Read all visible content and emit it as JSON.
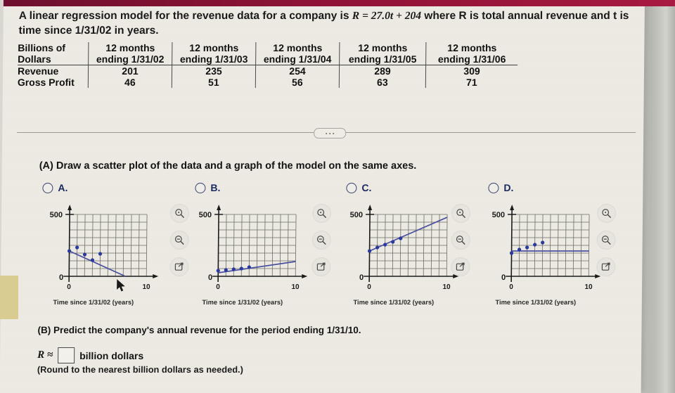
{
  "problem": {
    "stem_part1": "A linear regression model for the revenue data for a company is ",
    "stem_equation": "R = 27.0t + 204",
    "stem_part2": " where R is total annual revenue and t is time since 1/31/02 in years."
  },
  "table": {
    "corner_line1": "Billions of",
    "corner_line2": "Dollars",
    "columns": [
      {
        "line1": "12 months",
        "line2": "ending 1/31/02"
      },
      {
        "line1": "12 months",
        "line2": "ending 1/31/03"
      },
      {
        "line1": "12 months",
        "line2": "ending 1/31/04"
      },
      {
        "line1": "12 months",
        "line2": "ending 1/31/05"
      },
      {
        "line1": "12 months",
        "line2": "ending 1/31/06"
      }
    ],
    "rows": [
      {
        "label": "Revenue",
        "values": [
          "201",
          "235",
          "254",
          "289",
          "309"
        ]
      },
      {
        "label": "Gross Profit",
        "values": [
          "46",
          "51",
          "56",
          "63",
          "71"
        ]
      }
    ]
  },
  "part_a": {
    "prompt": "(A) Draw a scatter plot of the data and a graph of the model on the same axes.",
    "options": [
      {
        "label": "A.",
        "selected": false
      },
      {
        "label": "B.",
        "selected": false
      },
      {
        "label": "C.",
        "selected": false
      },
      {
        "label": "D.",
        "selected": false
      }
    ]
  },
  "part_b": {
    "prompt": "(B) Predict the company's annual revenue for the period ending 1/31/10.",
    "r_symbol": "R ≈",
    "answer_value": "",
    "units": "billion dollars",
    "note": "(Round to the nearest billion dollars as needed.)"
  },
  "icons": {
    "zoom_in": "zoom-in-icon",
    "zoom_out": "zoom-out-icon",
    "popout": "open-in-new-window-icon",
    "ellipsis": "more-options-icon"
  },
  "colors": {
    "point": "#2b3a9c",
    "line": "#4a4fa0",
    "grid": "#6d6d66",
    "axis": "#1b1b1b",
    "accent_band": "#8e1336",
    "option_label": "#1b2a63"
  },
  "chart_data": [
    {
      "id": "option-a",
      "type": "scatter",
      "title": "A.",
      "xlabel": "Time since 1/31/02 (years)",
      "ylabel": "",
      "xlim": [
        0,
        10
      ],
      "ylim": [
        0,
        500
      ],
      "xticks": [
        0,
        10
      ],
      "yticks": [
        0,
        500
      ],
      "grid": true,
      "scatter": {
        "x": [
          0,
          1,
          2,
          3,
          4
        ],
        "y": [
          201,
          235,
          178,
          131,
          190
        ]
      },
      "series": [
        {
          "name": "model",
          "x": [
            0,
            7.2
          ],
          "y": [
            204,
            0
          ]
        }
      ]
    },
    {
      "id": "option-b",
      "type": "scatter",
      "title": "B.",
      "xlabel": "Time since 1/31/02 (years)",
      "ylabel": "",
      "xlim": [
        0,
        10
      ],
      "ylim": [
        0,
        500
      ],
      "xticks": [
        0,
        10
      ],
      "yticks": [
        0,
        500
      ],
      "grid": true,
      "scatter": {
        "x": [
          0,
          1,
          2,
          3,
          4
        ],
        "y": [
          46,
          51,
          56,
          63,
          71
        ]
      },
      "series": [
        {
          "name": "model",
          "x": [
            0,
            10
          ],
          "y": [
            30,
            120
          ]
        }
      ]
    },
    {
      "id": "option-c",
      "type": "scatter",
      "title": "C.",
      "xlabel": "Time since 1/31/02 (years)",
      "ylabel": "",
      "xlim": [
        0,
        10
      ],
      "ylim": [
        0,
        500
      ],
      "xticks": [
        0,
        10
      ],
      "yticks": [
        0,
        500
      ],
      "grid": true,
      "scatter": {
        "x": [
          0,
          1,
          2,
          3,
          4
        ],
        "y": [
          201,
          235,
          254,
          289,
          309
        ]
      },
      "series": [
        {
          "name": "R = 27.0t + 204",
          "x": [
            0,
            10
          ],
          "y": [
            204,
            474
          ]
        }
      ]
    },
    {
      "id": "option-d",
      "type": "scatter",
      "title": "D.",
      "xlabel": "Time since 1/31/02 (years)",
      "ylabel": "",
      "xlim": [
        0,
        10
      ],
      "ylim": [
        0,
        500
      ],
      "xticks": [
        0,
        10
      ],
      "yticks": [
        0,
        500
      ],
      "grid": true,
      "scatter": {
        "x": [
          0,
          1,
          2,
          3,
          4
        ],
        "y": [
          201,
          235,
          254,
          289,
          309
        ]
      },
      "series": [
        {
          "name": "constant",
          "x": [
            0,
            10
          ],
          "y": [
            204,
            204
          ]
        }
      ]
    }
  ]
}
